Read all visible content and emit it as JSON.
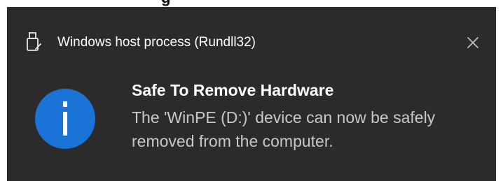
{
  "toast": {
    "app_name": "Windows host process (Rundll32)",
    "title": "Safe To Remove Hardware",
    "message": "The 'WinPE (D:)' device can now be safely removed from the computer.",
    "app_icon": "usb-drive-icon",
    "main_icon": "info-icon",
    "close_icon": "close-icon"
  },
  "colors": {
    "background": "#2b2b2b",
    "title_text": "#ffffff",
    "body_text": "#c8c8c8",
    "info_accent": "#1a74d8"
  }
}
